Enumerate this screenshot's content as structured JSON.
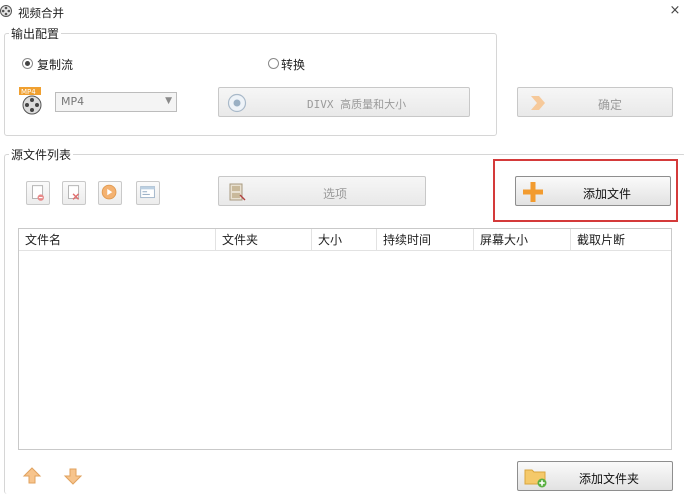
{
  "window": {
    "title": "视频合并",
    "close_glyph": "×"
  },
  "output_config": {
    "group_title": "输出配置",
    "radio_copy_stream": {
      "label": "复制流",
      "checked": true
    },
    "radio_convert": {
      "label": "转换",
      "checked": false
    },
    "format_select": {
      "value": "MP4",
      "icon": "mp4-file-icon"
    },
    "preset_button": {
      "label": "DIVX 高质量和大小",
      "enabled": false
    },
    "ok_button": {
      "label": "确定",
      "enabled": false
    }
  },
  "source_files": {
    "group_title": "源文件列表",
    "toolbar_icons": [
      "remove-file-icon",
      "clear-list-icon",
      "play-icon",
      "info-icon"
    ],
    "options_button": {
      "label": "选项",
      "enabled": false
    },
    "add_file_button": {
      "label": "添加文件",
      "enabled": true
    },
    "table": {
      "columns": [
        "文件名",
        "文件夹",
        "大小",
        "持续时间",
        "屏幕大小",
        "截取片断"
      ],
      "rows": []
    },
    "move_up_icon": "arrow-up-icon",
    "move_down_icon": "arrow-down-icon",
    "add_folder_button": {
      "label": "添加文件夹",
      "enabled": true
    }
  },
  "colors": {
    "highlight": "#d43a3a",
    "accent_orange": "#f29b2f"
  }
}
